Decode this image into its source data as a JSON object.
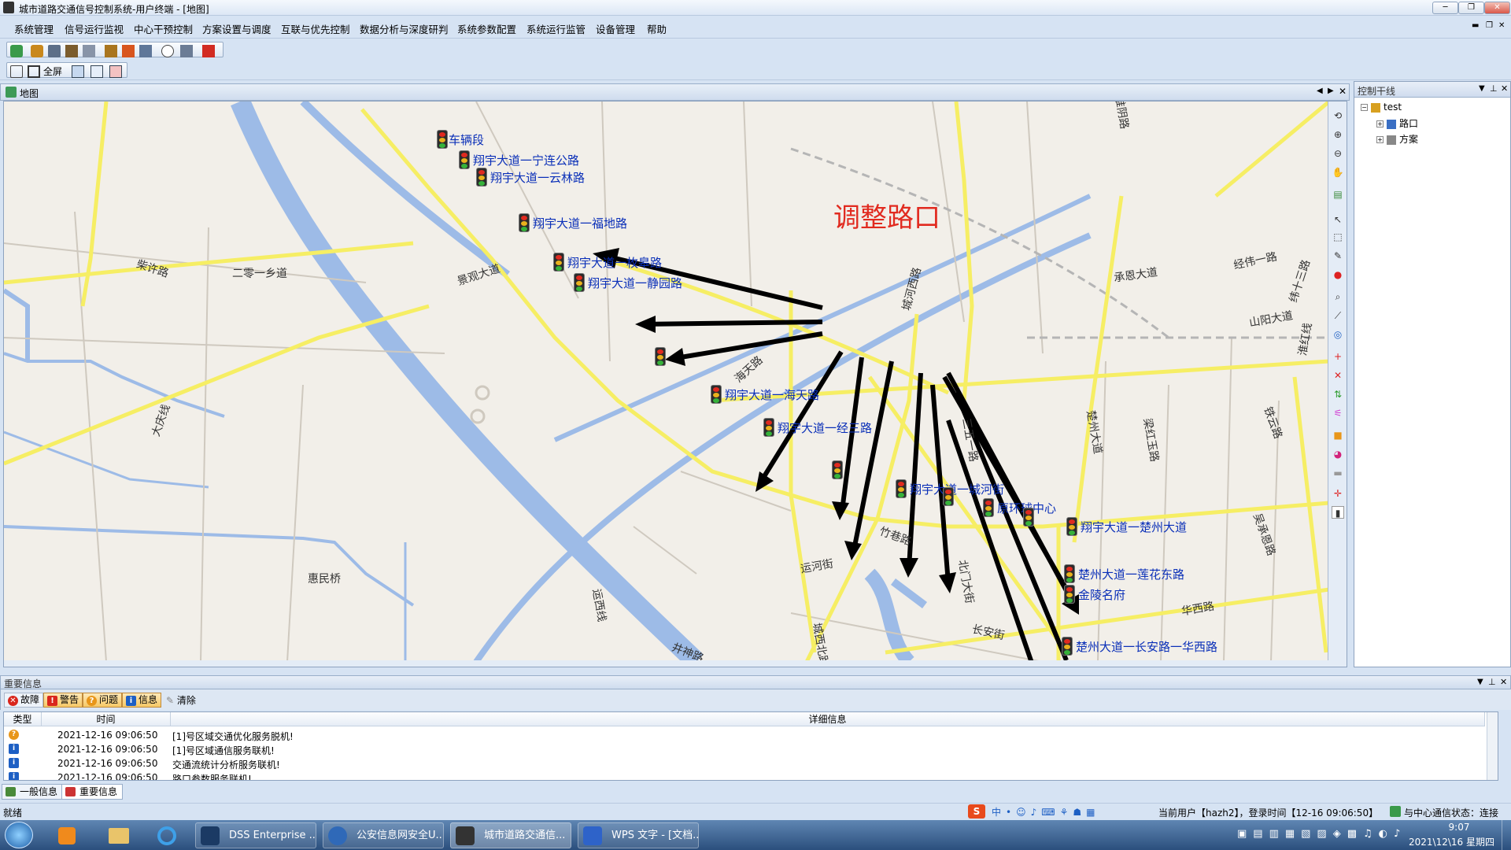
{
  "window": {
    "title": "城市道路交通信号控制系统-用户终端 - [地图]",
    "minimize": "─",
    "restore": "❐",
    "close": "✕"
  },
  "menu": [
    "系统管理",
    "信号运行监视",
    "中心干预控制",
    "方案设置与调度",
    "互联与优先控制",
    "数据分析与深度研判",
    "系统参数配置",
    "系统运行监管",
    "设备管理",
    "帮助"
  ],
  "toolbar": {
    "fullscreen_label": "全屏"
  },
  "map_tab": {
    "label": "地图"
  },
  "map": {
    "annotation": "调整路口",
    "intersections": [
      {
        "name": "车辆段"
      },
      {
        "name": "翔宇大道一宁连公路"
      },
      {
        "name": "翔宇大道一云林路"
      },
      {
        "name": "翔宇大道一福地路"
      },
      {
        "name": "翔宇大道一枚皋路"
      },
      {
        "name": "翔宇大道一静园路"
      },
      {
        "name": ""
      },
      {
        "name": "翔宇大道一海天路"
      },
      {
        "name": "翔宇大道一经三路"
      },
      {
        "name": ""
      },
      {
        "name": "翔宇大道一城河街"
      },
      {
        "name": ""
      },
      {
        "name": "原环球中心"
      },
      {
        "name": ""
      },
      {
        "name": "翔宇大道一楚州大道"
      },
      {
        "name": "楚州大道一莲花东路"
      },
      {
        "name": "金陵名府"
      },
      {
        "name": "楚州大道一长安路一华西路"
      }
    ],
    "roads": [
      "柴许路",
      "二零一乡道",
      "景观大道",
      "海天路",
      "城河西路",
      "承恩大道",
      "经伟一路",
      "纬十三路",
      "山阳大道",
      "淮红线",
      "铁云路",
      "楚州大道",
      "梁红玉路",
      "吴承恩路",
      "竹巷路",
      "运河街",
      "北门大街",
      "长安街",
      "华西路",
      "惠民桥",
      "大庆线",
      "运西线",
      "井神路",
      "城西北路",
      "淮阴路",
      "三五一路"
    ]
  },
  "right_panel": {
    "title": "控制干线",
    "tree": [
      {
        "label": "test",
        "level": 0
      },
      {
        "label": "路口",
        "level": 1
      },
      {
        "label": "方案",
        "level": 1
      }
    ]
  },
  "bottom_panel": {
    "title": "重要信息",
    "filters": [
      {
        "label": "故障",
        "color": "#d9261c",
        "glyph": "✕"
      },
      {
        "label": "警告",
        "color": "#d9261c",
        "glyph": "!"
      },
      {
        "label": "问题",
        "color": "#e8961a",
        "glyph": "?"
      },
      {
        "label": "信息",
        "color": "#1d5fc4",
        "glyph": "i"
      }
    ],
    "clear_label": "清除",
    "columns": [
      "类型",
      "时间",
      "详细信息"
    ],
    "rows": [
      {
        "type": "question",
        "time": "2021-12-16 09:06:50",
        "detail": "[1]号区域交通优化服务脱机!"
      },
      {
        "type": "info",
        "time": "2021-12-16 09:06:50",
        "detail": "[1]号区域通信服务联机!"
      },
      {
        "type": "info",
        "time": "2021-12-16 09:06:50",
        "detail": "交通流统计分析服务联机!"
      },
      {
        "type": "info",
        "time": "2021-12-16 09:06:50",
        "detail": "路口参数服务联机!"
      }
    ],
    "tabs": [
      "一般信息",
      "重要信息"
    ]
  },
  "status": {
    "left": "就绪",
    "user": "当前用户【hazh2】，登录时间【12-16 09:06:50】",
    "center": "与中心通信状态：连接"
  },
  "taskbar": {
    "tasks": [
      "DSS Enterprise ...",
      "公安信息网安全U...",
      "城市道路交通信...",
      "WPS 文字 - [文档..."
    ],
    "time": "9:07",
    "date": "2021\\12\\16 星期四"
  }
}
